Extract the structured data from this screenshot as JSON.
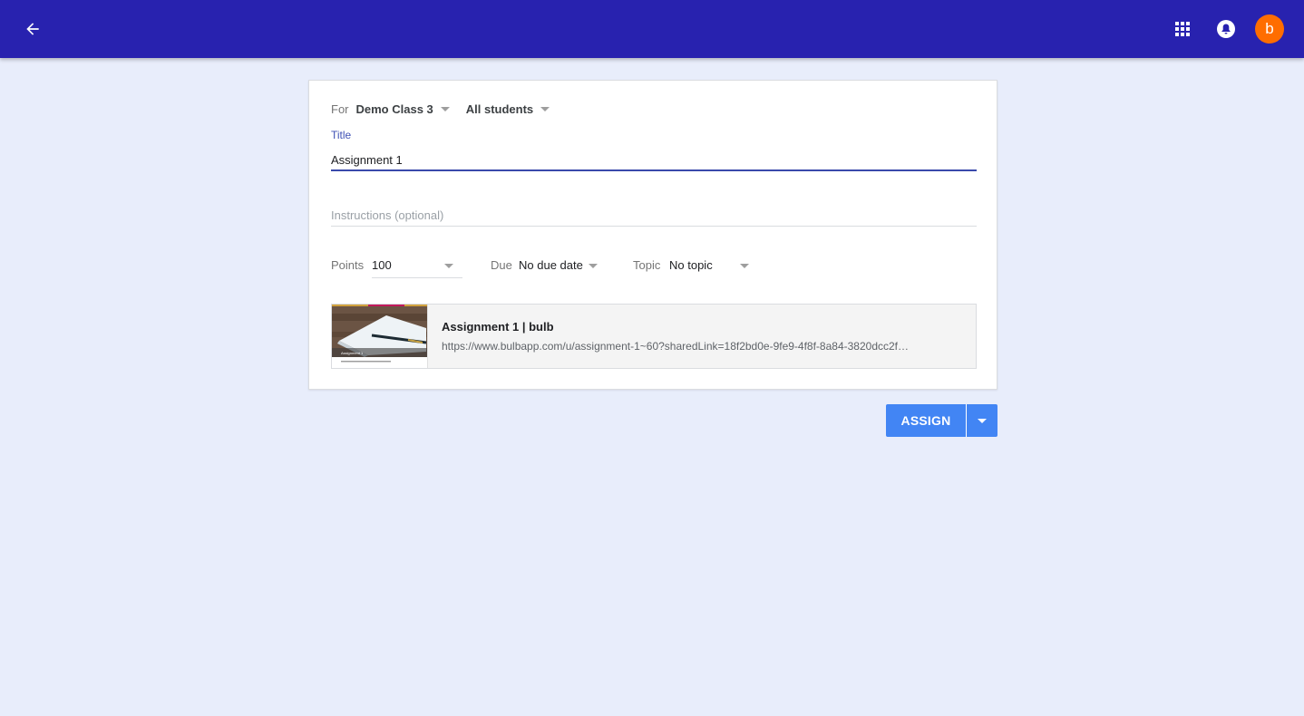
{
  "header": {
    "back_icon": "arrow-left-icon",
    "apps_icon": "apps-grid-icon",
    "notifications_icon": "bell-icon",
    "avatar_letter": "b",
    "bar_color": "#2822af",
    "avatar_color": "#ff6d00"
  },
  "form": {
    "for_label": "For",
    "class_value": "Demo Class 3",
    "students_value": "All students",
    "title_label": "Title",
    "title_value": "Assignment 1",
    "instructions_placeholder": "Instructions (optional)",
    "instructions_value": "",
    "points_label": "Points",
    "points_value": "100",
    "due_label": "Due",
    "due_value": "No due date",
    "topic_label": "Topic",
    "topic_value": "No topic"
  },
  "attachment": {
    "title": "Assignment 1 | bulb",
    "url": "https://www.bulbapp.com/u/assignment-1~60?sharedLink=18f2bd0e-9fe9-4f8f-8a84-3820dcc2f…",
    "thumbnail_caption": "Assignment 1"
  },
  "actions": {
    "assign_label": "ASSIGN",
    "assign_menu_icon": "caret-down-icon",
    "button_color": "#4285f4"
  }
}
